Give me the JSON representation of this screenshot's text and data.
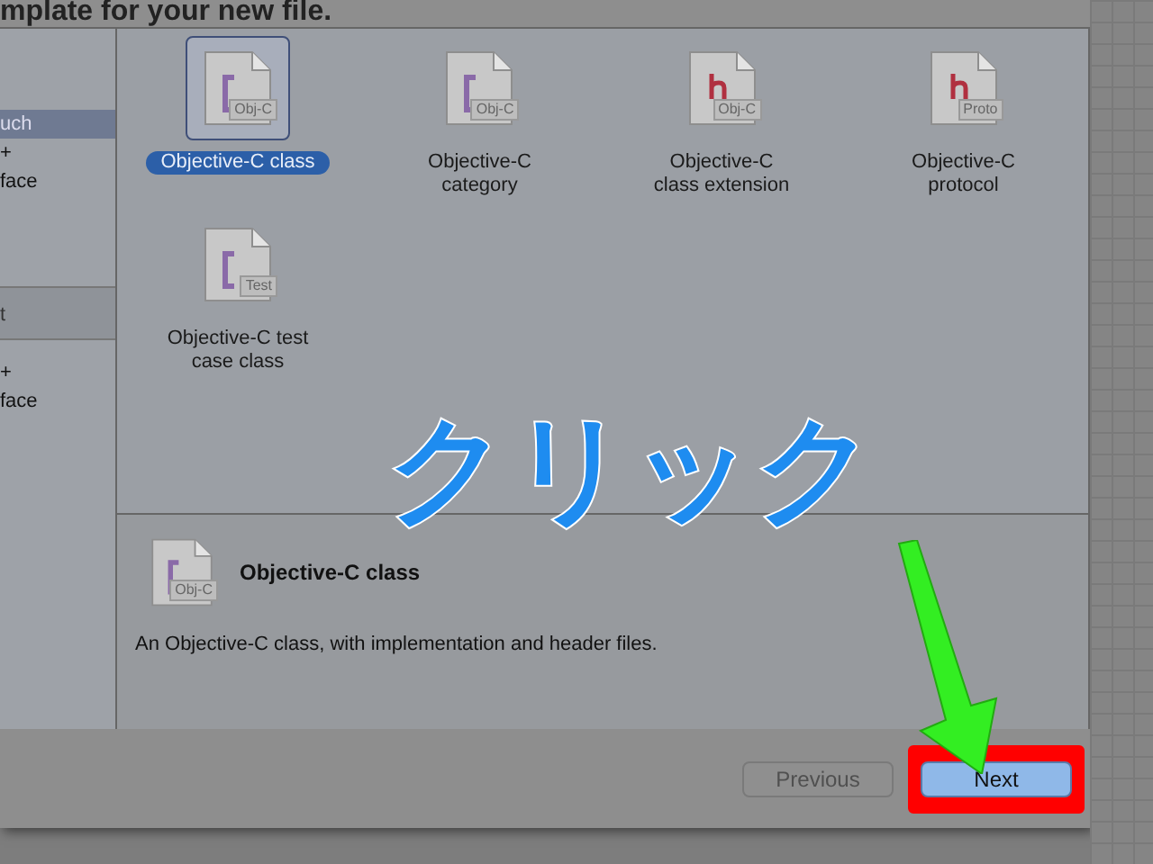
{
  "dialog": {
    "title": "mplate for your new file."
  },
  "sidebar": {
    "sections": [
      {
        "items": [
          {
            "label": "uch",
            "selected": true
          },
          {
            "label": "+",
            "selected": false
          },
          {
            "label": "face",
            "selected": false
          }
        ]
      },
      {
        "header": "t",
        "items": [
          {
            "label": "+",
            "selected": false
          },
          {
            "label": "face",
            "selected": false
          }
        ]
      }
    ]
  },
  "templates": [
    {
      "name": "Objective-C class",
      "kind": "c",
      "badge": "Obj-C",
      "selected": true
    },
    {
      "name": "Objective-C category",
      "kind": "c",
      "badge": "Obj-C",
      "selected": false
    },
    {
      "name": "Objective-C class extension",
      "kind": "h",
      "badge": "Obj-C",
      "selected": false
    },
    {
      "name": "Objective-C protocol",
      "kind": "h",
      "badge": "Proto",
      "selected": false
    },
    {
      "name": "Objective-C test case class",
      "kind": "c",
      "badge": "Test",
      "selected": false
    }
  ],
  "detail": {
    "title": "Objective-C class",
    "kind": "c",
    "badge": "Obj-C",
    "description": "An Objective-C class, with implementation and header files."
  },
  "buttons": [
    {
      "label": "Previous",
      "disabled": true,
      "highlighted": false
    },
    {
      "label": "Next",
      "disabled": false,
      "highlighted": true
    }
  ],
  "annotation": {
    "text": "クリック"
  }
}
